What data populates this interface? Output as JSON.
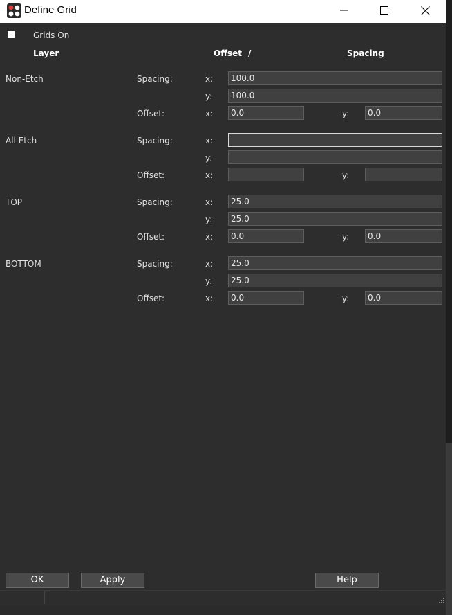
{
  "window": {
    "title": "Define Grid"
  },
  "grids_on": {
    "label": "Grids On",
    "checked": true
  },
  "headers": {
    "layer": "Layer",
    "offset": "Offset",
    "slash": "/",
    "spacing": "Spacing"
  },
  "labels": {
    "spacing": "Spacing:",
    "offset": "Offset:",
    "x": "x:",
    "y": "y:"
  },
  "layers": [
    {
      "name": "Non-Etch",
      "spacing_x": "100.0",
      "spacing_y": "100.0",
      "offset_x": "0.0",
      "offset_y": "0.0"
    },
    {
      "name": "All Etch",
      "spacing_x": "",
      "spacing_y": "",
      "offset_x": "",
      "offset_y": ""
    },
    {
      "name": "TOP",
      "spacing_x": "25.0",
      "spacing_y": "25.0",
      "offset_x": "0.0",
      "offset_y": "0.0"
    },
    {
      "name": "BOTTOM",
      "spacing_x": "25.0",
      "spacing_y": "25.0",
      "offset_x": "0.0",
      "offset_y": "0.0"
    }
  ],
  "buttons": {
    "ok": "OK",
    "apply": "Apply",
    "help": "Help"
  },
  "icons": {
    "app": "grid-app-icon",
    "minimize": "minimize-icon",
    "maximize": "maximize-icon",
    "close": "close-icon",
    "grip": "resize-grip-icon"
  }
}
